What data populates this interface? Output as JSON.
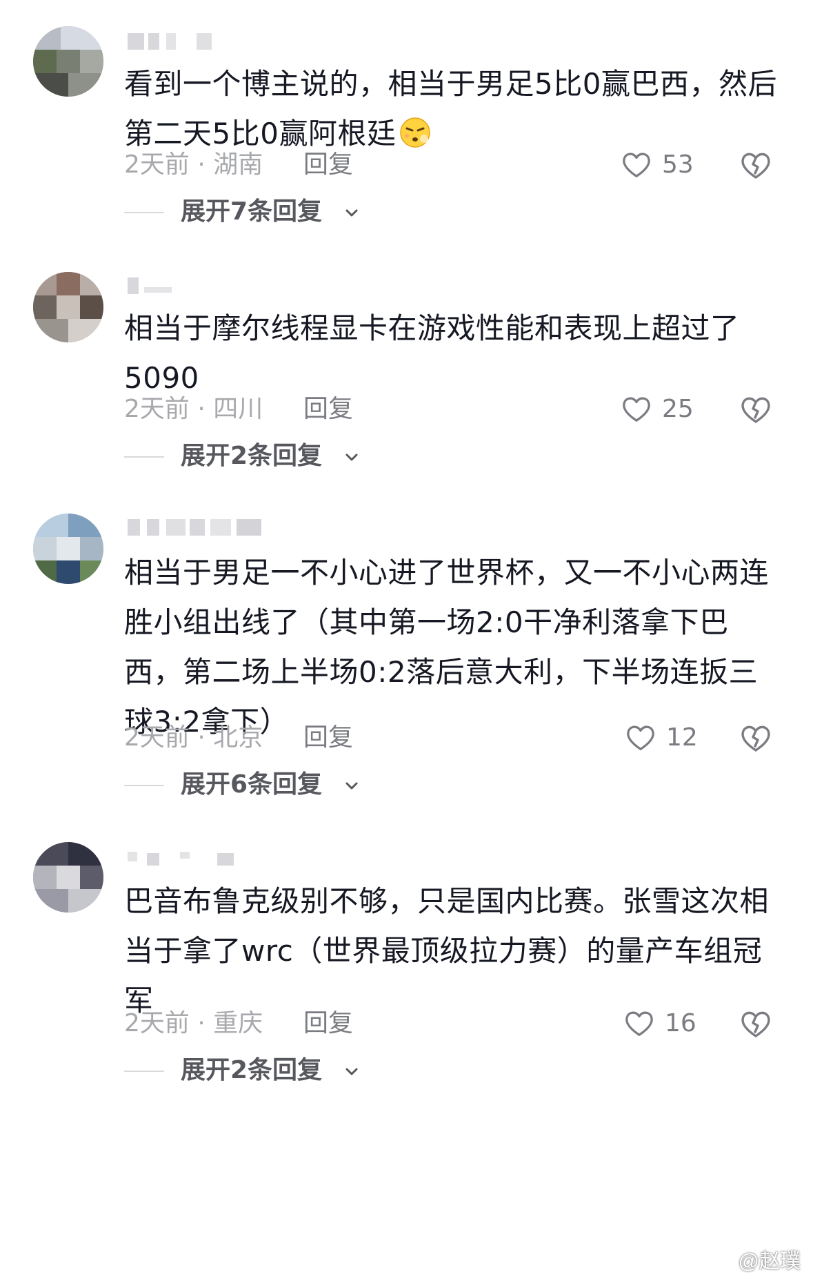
{
  "comments": [
    {
      "username": "▪▪▪▪",
      "text": "看到一个博主说的，相当于男足5比0赢巴西，然后第二天5比0赢阿根廷",
      "emoji": "face-exhaling-icon",
      "time_location": "2天前 · 湖南",
      "reply_label": "回复",
      "likes": "53",
      "expand_label": "展开7条回复"
    },
    {
      "username": "▪▪",
      "text": "相当于摩尔线程显卡在游戏性能和表现上超过了5090",
      "time_location": "2天前 · 四川",
      "reply_label": "回复",
      "likes": "25",
      "expand_label": "展开2条回复"
    },
    {
      "username": "▪▪▪▪▪▪▪",
      "text": "相当于男足一不小心进了世界杯，又一不小心两连胜小组出线了（其中第一场2:0干净利落拿下巴西，第二场上半场0:2落后意大利，下半场连扳三球3:2拿下）",
      "time_location": "2天前 · 北京",
      "reply_label": "回复",
      "likes": "12",
      "expand_label": "展开6条回复"
    },
    {
      "username": "▪▪▪▪",
      "text": "巴音布鲁克级别不够，只是国内比赛。张雪这次相当于拿了wrc（世界最顶级拉力赛）的量产车组冠军",
      "time_location": "2天前 · 重庆",
      "reply_label": "回复",
      "likes": "16",
      "expand_label": "展开2条回复"
    }
  ],
  "watermark": "@赵璞",
  "colors": {
    "text": "#161823",
    "meta": "#a8a9ad",
    "action": "#7b7c82",
    "expand": "#57585e"
  }
}
